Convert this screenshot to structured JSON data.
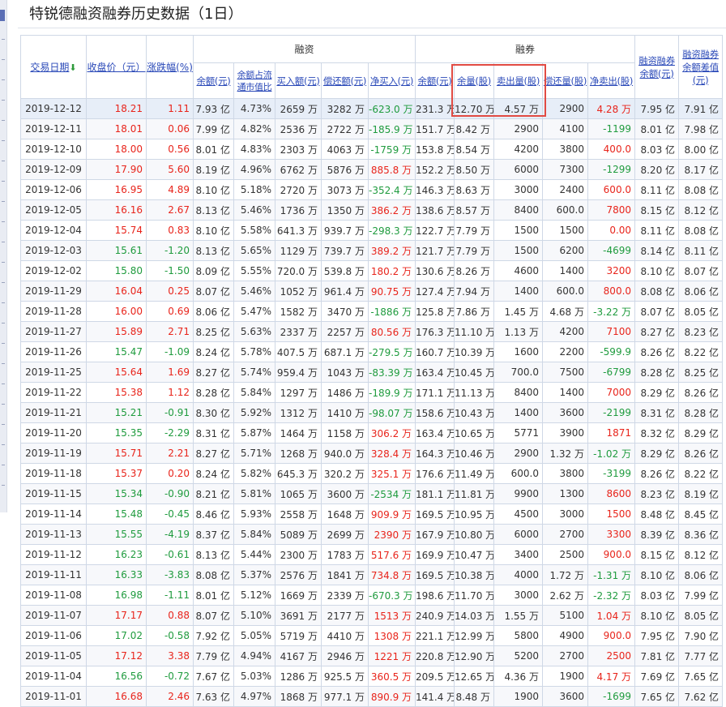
{
  "title": "特锐德融资融券历史数据（1日）",
  "headers": {
    "date": "交易日期",
    "close": "收盘价（元）",
    "change": "涨跌幅(%)",
    "margin_group": "融资",
    "margin_balance": "余额(元)",
    "margin_ratio": "余额占流通市值比",
    "margin_buy": "买入额(元)",
    "margin_repay": "偿还额(元)",
    "margin_net": "净买入(元)",
    "short_group": "融券",
    "short_balance": "余额(元)",
    "short_volume": "余量(股)",
    "short_sell": "卖出量(股)",
    "short_repay": "偿还量(股)",
    "short_net": "净卖出(股)",
    "total_balance": "融资融券余额(元)",
    "balance_diff": "融资融券余额差值(元)"
  },
  "rows": [
    {
      "date": "2019-12-12",
      "close": "18.21",
      "chg": "1.11",
      "mb": "7.93 亿",
      "mr": "4.73%",
      "buy": "2659 万",
      "repay": "3282 万",
      "net": "-623.0 万",
      "sb": "231.3 万",
      "sv": "12.70 万",
      "ss": "4.57 万",
      "sr": "2900",
      "sn": "4.28 万",
      "tb": "7.95 亿",
      "bd": "7.91 亿"
    },
    {
      "date": "2019-12-11",
      "close": "18.01",
      "chg": "0.06",
      "mb": "7.99 亿",
      "mr": "4.82%",
      "buy": "2536 万",
      "repay": "2722 万",
      "net": "-185.9 万",
      "sb": "151.7 万",
      "sv": "8.42 万",
      "ss": "2900",
      "sr": "4100",
      "sn": "-1199",
      "tb": "8.01 亿",
      "bd": "7.98 亿"
    },
    {
      "date": "2019-12-10",
      "close": "18.00",
      "chg": "0.56",
      "mb": "8.01 亿",
      "mr": "4.83%",
      "buy": "2303 万",
      "repay": "4063 万",
      "net": "-1759 万",
      "sb": "153.8 万",
      "sv": "8.54 万",
      "ss": "4200",
      "sr": "3800",
      "sn": "400.0",
      "tb": "8.03 亿",
      "bd": "8.00 亿"
    },
    {
      "date": "2019-12-09",
      "close": "17.90",
      "chg": "5.60",
      "mb": "8.19 亿",
      "mr": "4.96%",
      "buy": "6762 万",
      "repay": "5876 万",
      "net": "885.8 万",
      "sb": "152.2 万",
      "sv": "8.50 万",
      "ss": "6000",
      "sr": "7300",
      "sn": "-1299",
      "tb": "8.20 亿",
      "bd": "8.17 亿"
    },
    {
      "date": "2019-12-06",
      "close": "16.95",
      "chg": "4.89",
      "mb": "8.10 亿",
      "mr": "5.18%",
      "buy": "2720 万",
      "repay": "3073 万",
      "net": "-352.4 万",
      "sb": "146.3 万",
      "sv": "8.63 万",
      "ss": "3000",
      "sr": "2400",
      "sn": "600.0",
      "tb": "8.11 亿",
      "bd": "8.08 亿"
    },
    {
      "date": "2019-12-05",
      "close": "16.16",
      "chg": "2.67",
      "mb": "8.13 亿",
      "mr": "5.46%",
      "buy": "1736 万",
      "repay": "1350 万",
      "net": "386.2 万",
      "sb": "138.6 万",
      "sv": "8.57 万",
      "ss": "8400",
      "sr": "600.0",
      "sn": "7800",
      "tb": "8.15 亿",
      "bd": "8.12 亿"
    },
    {
      "date": "2019-12-04",
      "close": "15.74",
      "chg": "0.83",
      "mb": "8.10 亿",
      "mr": "5.58%",
      "buy": "641.3 万",
      "repay": "939.7 万",
      "net": "-298.3 万",
      "sb": "122.7 万",
      "sv": "7.79 万",
      "ss": "1500",
      "sr": "1500",
      "sn": "0.00",
      "tb": "8.11 亿",
      "bd": "8.08 亿"
    },
    {
      "date": "2019-12-03",
      "close": "15.61",
      "chg": "-1.20",
      "mb": "8.13 亿",
      "mr": "5.65%",
      "buy": "1129 万",
      "repay": "739.7 万",
      "net": "389.2 万",
      "sb": "121.7 万",
      "sv": "7.79 万",
      "ss": "1500",
      "sr": "6200",
      "sn": "-4699",
      "tb": "8.14 亿",
      "bd": "8.11 亿"
    },
    {
      "date": "2019-12-02",
      "close": "15.80",
      "chg": "-1.50",
      "mb": "8.09 亿",
      "mr": "5.55%",
      "buy": "720.0 万",
      "repay": "539.8 万",
      "net": "180.2 万",
      "sb": "130.6 万",
      "sv": "8.26 万",
      "ss": "4600",
      "sr": "1400",
      "sn": "3200",
      "tb": "8.10 亿",
      "bd": "8.07 亿"
    },
    {
      "date": "2019-11-29",
      "close": "16.04",
      "chg": "0.25",
      "mb": "8.07 亿",
      "mr": "5.46%",
      "buy": "1052 万",
      "repay": "961.4 万",
      "net": "90.75 万",
      "sb": "127.4 万",
      "sv": "7.94 万",
      "ss": "1400",
      "sr": "600.0",
      "sn": "800.0",
      "tb": "8.08 亿",
      "bd": "8.06 亿"
    },
    {
      "date": "2019-11-28",
      "close": "16.00",
      "chg": "0.69",
      "mb": "8.06 亿",
      "mr": "5.47%",
      "buy": "1582 万",
      "repay": "3470 万",
      "net": "-1886 万",
      "sb": "125.8 万",
      "sv": "7.86 万",
      "ss": "1.45 万",
      "sr": "4.68 万",
      "sn": "-3.22 万",
      "tb": "8.07 亿",
      "bd": "8.05 亿"
    },
    {
      "date": "2019-11-27",
      "close": "15.89",
      "chg": "2.71",
      "mb": "8.25 亿",
      "mr": "5.63%",
      "buy": "2337 万",
      "repay": "2257 万",
      "net": "80.56 万",
      "sb": "176.3 万",
      "sv": "11.10 万",
      "ss": "1.13 万",
      "sr": "4200",
      "sn": "7100",
      "tb": "8.27 亿",
      "bd": "8.23 亿"
    },
    {
      "date": "2019-11-26",
      "close": "15.47",
      "chg": "-1.09",
      "mb": "8.24 亿",
      "mr": "5.78%",
      "buy": "407.5 万",
      "repay": "687.1 万",
      "net": "-279.5 万",
      "sb": "160.7 万",
      "sv": "10.39 万",
      "ss": "1600",
      "sr": "2200",
      "sn": "-599.9",
      "tb": "8.26 亿",
      "bd": "8.22 亿"
    },
    {
      "date": "2019-11-25",
      "close": "15.64",
      "chg": "1.69",
      "mb": "8.27 亿",
      "mr": "5.74%",
      "buy": "959.4 万",
      "repay": "1043 万",
      "net": "-83.39 万",
      "sb": "163.4 万",
      "sv": "10.45 万",
      "ss": "700.0",
      "sr": "7500",
      "sn": "-6799",
      "tb": "8.28 亿",
      "bd": "8.25 亿"
    },
    {
      "date": "2019-11-22",
      "close": "15.38",
      "chg": "1.12",
      "mb": "8.28 亿",
      "mr": "5.84%",
      "buy": "1297 万",
      "repay": "1486 万",
      "net": "-189.9 万",
      "sb": "171.1 万",
      "sv": "11.13 万",
      "ss": "8400",
      "sr": "1400",
      "sn": "7000",
      "tb": "8.29 亿",
      "bd": "8.26 亿"
    },
    {
      "date": "2019-11-21",
      "close": "15.21",
      "chg": "-0.91",
      "mb": "8.30 亿",
      "mr": "5.92%",
      "buy": "1312 万",
      "repay": "1410 万",
      "net": "-98.07 万",
      "sb": "158.6 万",
      "sv": "10.43 万",
      "ss": "1400",
      "sr": "3600",
      "sn": "-2199",
      "tb": "8.31 亿",
      "bd": "8.28 亿"
    },
    {
      "date": "2019-11-20",
      "close": "15.35",
      "chg": "-2.29",
      "mb": "8.31 亿",
      "mr": "5.87%",
      "buy": "1464 万",
      "repay": "1158 万",
      "net": "306.2 万",
      "sb": "163.4 万",
      "sv": "10.65 万",
      "ss": "5771",
      "sr": "3900",
      "sn": "1871",
      "tb": "8.32 亿",
      "bd": "8.29 亿"
    },
    {
      "date": "2019-11-19",
      "close": "15.71",
      "chg": "2.21",
      "mb": "8.27 亿",
      "mr": "5.71%",
      "buy": "1268 万",
      "repay": "940.0 万",
      "net": "328.4 万",
      "sb": "164.3 万",
      "sv": "10.46 万",
      "ss": "2900",
      "sr": "1.32 万",
      "sn": "-1.02 万",
      "tb": "8.29 亿",
      "bd": "8.26 亿"
    },
    {
      "date": "2019-11-18",
      "close": "15.37",
      "chg": "0.20",
      "mb": "8.24 亿",
      "mr": "5.82%",
      "buy": "645.3 万",
      "repay": "320.2 万",
      "net": "325.1 万",
      "sb": "176.6 万",
      "sv": "11.49 万",
      "ss": "600.0",
      "sr": "3800",
      "sn": "-3199",
      "tb": "8.26 亿",
      "bd": "8.22 亿"
    },
    {
      "date": "2019-11-15",
      "close": "15.34",
      "chg": "-0.90",
      "mb": "8.21 亿",
      "mr": "5.81%",
      "buy": "1065 万",
      "repay": "3600 万",
      "net": "-2534 万",
      "sb": "181.1 万",
      "sv": "11.81 万",
      "ss": "9900",
      "sr": "1300",
      "sn": "8600",
      "tb": "8.23 亿",
      "bd": "8.19 亿"
    },
    {
      "date": "2019-11-14",
      "close": "15.48",
      "chg": "-0.45",
      "mb": "8.46 亿",
      "mr": "5.93%",
      "buy": "2558 万",
      "repay": "1648 万",
      "net": "909.9 万",
      "sb": "169.5 万",
      "sv": "10.95 万",
      "ss": "4500",
      "sr": "3000",
      "sn": "1500",
      "tb": "8.48 亿",
      "bd": "8.45 亿"
    },
    {
      "date": "2019-11-13",
      "close": "15.55",
      "chg": "-4.19",
      "mb": "8.37 亿",
      "mr": "5.84%",
      "buy": "5089 万",
      "repay": "2699 万",
      "net": "2390 万",
      "sb": "167.9 万",
      "sv": "10.80 万",
      "ss": "6000",
      "sr": "2700",
      "sn": "3300",
      "tb": "8.39 亿",
      "bd": "8.36 亿"
    },
    {
      "date": "2019-11-12",
      "close": "16.23",
      "chg": "-0.61",
      "mb": "8.13 亿",
      "mr": "5.44%",
      "buy": "2300 万",
      "repay": "1783 万",
      "net": "517.6 万",
      "sb": "169.9 万",
      "sv": "10.47 万",
      "ss": "3400",
      "sr": "2500",
      "sn": "900.0",
      "tb": "8.15 亿",
      "bd": "8.12 亿"
    },
    {
      "date": "2019-11-11",
      "close": "16.33",
      "chg": "-3.83",
      "mb": "8.08 亿",
      "mr": "5.37%",
      "buy": "2576 万",
      "repay": "1841 万",
      "net": "734.8 万",
      "sb": "169.5 万",
      "sv": "10.38 万",
      "ss": "4000",
      "sr": "1.72 万",
      "sn": "-1.31 万",
      "tb": "8.10 亿",
      "bd": "8.06 亿"
    },
    {
      "date": "2019-11-08",
      "close": "16.98",
      "chg": "-1.11",
      "mb": "8.01 亿",
      "mr": "5.12%",
      "buy": "1669 万",
      "repay": "2339 万",
      "net": "-670.3 万",
      "sb": "198.6 万",
      "sv": "11.70 万",
      "ss": "3000",
      "sr": "2.62 万",
      "sn": "-2.32 万",
      "tb": "8.03 亿",
      "bd": "7.99 亿"
    },
    {
      "date": "2019-11-07",
      "close": "17.17",
      "chg": "0.88",
      "mb": "8.07 亿",
      "mr": "5.10%",
      "buy": "3691 万",
      "repay": "2177 万",
      "net": "1513 万",
      "sb": "240.9 万",
      "sv": "14.03 万",
      "ss": "1.55 万",
      "sr": "5100",
      "sn": "1.04 万",
      "tb": "8.10 亿",
      "bd": "8.05 亿"
    },
    {
      "date": "2019-11-06",
      "close": "17.02",
      "chg": "-0.58",
      "mb": "7.92 亿",
      "mr": "5.05%",
      "buy": "5719 万",
      "repay": "4410 万",
      "net": "1308 万",
      "sb": "221.1 万",
      "sv": "12.99 万",
      "ss": "5800",
      "sr": "4900",
      "sn": "900.0",
      "tb": "7.95 亿",
      "bd": "7.90 亿"
    },
    {
      "date": "2019-11-05",
      "close": "17.12",
      "chg": "3.38",
      "mb": "7.79 亿",
      "mr": "4.94%",
      "buy": "4167 万",
      "repay": "2946 万",
      "net": "1221 万",
      "sb": "220.8 万",
      "sv": "12.90 万",
      "ss": "5200",
      "sr": "2700",
      "sn": "2500",
      "tb": "7.81 亿",
      "bd": "7.77 亿"
    },
    {
      "date": "2019-11-04",
      "close": "16.56",
      "chg": "-0.72",
      "mb": "7.67 亿",
      "mr": "5.03%",
      "buy": "1286 万",
      "repay": "925.5 万",
      "net": "360.5 万",
      "sb": "209.5 万",
      "sv": "12.65 万",
      "ss": "4.36 万",
      "sr": "1900",
      "sn": "4.17 万",
      "tb": "7.69 亿",
      "bd": "7.65 亿"
    },
    {
      "date": "2019-11-01",
      "close": "16.68",
      "chg": "2.46",
      "mb": "7.63 亿",
      "mr": "4.97%",
      "buy": "1868 万",
      "repay": "977.1 万",
      "net": "890.9 万",
      "sb": "141.4 万",
      "sv": "8.48 万",
      "ss": "1900",
      "sr": "3600",
      "sn": "-1699",
      "tb": "7.65 亿",
      "bd": "7.62 亿"
    }
  ],
  "colors": {
    "up": "#e8241b",
    "down": "#1f9b3e",
    "link": "#2a49b8",
    "highlight_box": "#e14b43"
  }
}
